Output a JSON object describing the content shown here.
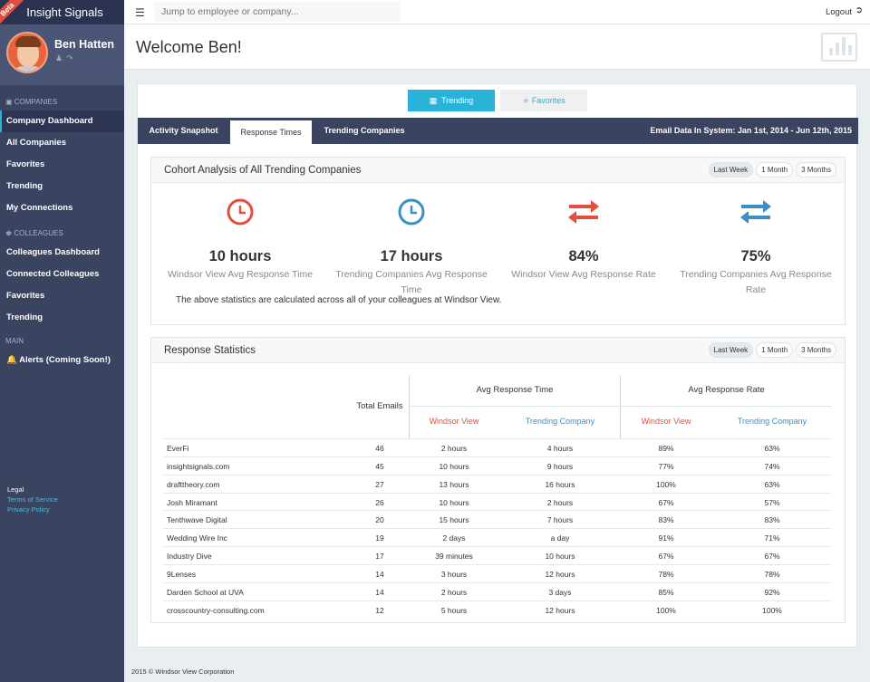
{
  "brand": {
    "name": "Insight Signals",
    "badge": "Beta"
  },
  "profile": {
    "name": "Ben Hatten"
  },
  "sidebar": {
    "section_companies": "COMPANIES",
    "companies": [
      "Company Dashboard",
      "All Companies",
      "Favorites",
      "Trending",
      "My Connections"
    ],
    "section_colleagues": "COLLEAGUES",
    "colleagues": [
      "Colleagues Dashboard",
      "Connected Colleagues",
      "Favorites",
      "Trending"
    ],
    "section_main": "MAIN",
    "alerts": "Alerts (Coming Soon!)",
    "legal": "Legal",
    "terms": "Terms of Service",
    "privacy": "Privacy Policy"
  },
  "topbar": {
    "search_placeholder": "Jump to employee or company...",
    "logout": "Logout"
  },
  "header": {
    "welcome": "Welcome Ben!"
  },
  "toggle": {
    "trending": "Trending",
    "favorites": "Favorites"
  },
  "tabs": [
    "Activity Snapshot",
    "Response Times",
    "Trending Companies"
  ],
  "email_data": "Email Data In System: Jan 1st, 2014 - Jun 12th, 2015",
  "ranges": [
    "Last Week",
    "1 Month",
    "3 Months"
  ],
  "cohort": {
    "title": "Cohort Analysis of All Trending Companies",
    "stats": [
      {
        "value": "10 hours",
        "label": "Windsor View Avg Response Time",
        "icon": "clock-icon",
        "color": "#e1503f"
      },
      {
        "value": "17 hours",
        "label": "Trending Companies Avg Response Time",
        "icon": "clock-icon",
        "color": "#3a8fc7"
      },
      {
        "value": "84%",
        "label": "Windsor View Avg Response Rate",
        "icon": "exchange-icon",
        "color": "#e1503f"
      },
      {
        "value": "75%",
        "label": "Trending Companies Avg Response Rate",
        "icon": "exchange-icon",
        "color": "#3a8fc7"
      }
    ],
    "note": "The above statistics are calculated across all of your colleagues at Windsor View."
  },
  "response": {
    "title": "Response Statistics",
    "total_emails": "Total Emails",
    "avg_time": "Avg Response Time",
    "avg_rate": "Avg Response Rate",
    "windsor": "Windsor View",
    "trending_company": "Trending Company",
    "rows": [
      [
        "EverFi",
        "46",
        "2 hours",
        "4 hours",
        "89%",
        "63%"
      ],
      [
        "insightsignals.com",
        "45",
        "10 hours",
        "9 hours",
        "77%",
        "74%"
      ],
      [
        "drafttheory.com",
        "27",
        "13 hours",
        "16 hours",
        "100%",
        "63%"
      ],
      [
        "Josh Miramant",
        "26",
        "10 hours",
        "2 hours",
        "67%",
        "57%"
      ],
      [
        "Tenthwave Digital",
        "20",
        "15 hours",
        "7 hours",
        "83%",
        "83%"
      ],
      [
        "Wedding Wire Inc",
        "19",
        "2 days",
        "a day",
        "91%",
        "71%"
      ],
      [
        "Industry Dive",
        "17",
        "39 minutes",
        "10 hours",
        "67%",
        "67%"
      ],
      [
        "9Lenses",
        "14",
        "3 hours",
        "12 hours",
        "78%",
        "78%"
      ],
      [
        "Darden School at UVA",
        "14",
        "2 hours",
        "3 days",
        "85%",
        "92%"
      ],
      [
        "crosscountry-consulting.com",
        "12",
        "5 hours",
        "12 hours",
        "100%",
        "100%"
      ]
    ]
  },
  "footer": "2015 © Windsor View Corporation"
}
